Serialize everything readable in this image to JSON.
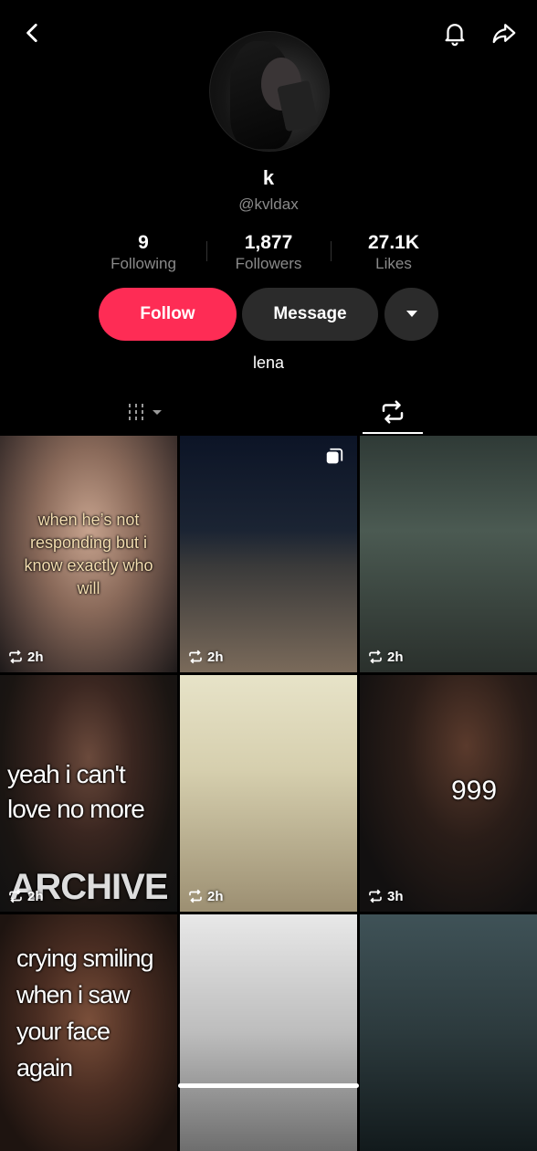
{
  "profile": {
    "display_name": "k",
    "handle": "@kvldax",
    "bio": "lena"
  },
  "stats": {
    "following": {
      "value": "9",
      "label": "Following"
    },
    "followers": {
      "value": "1,877",
      "label": "Followers"
    },
    "likes": {
      "value": "27.1K",
      "label": "Likes"
    }
  },
  "actions": {
    "follow_label": "Follow",
    "message_label": "Message"
  },
  "colors": {
    "accent": "#fe2c55",
    "button_dark": "#2b2b2b",
    "muted_text": "#8a8a8a"
  },
  "icons": [
    "back-icon",
    "bell-icon",
    "share-icon",
    "chevron-down-icon",
    "grid-icon",
    "repost-icon",
    "multi-photo-icon"
  ],
  "videos": [
    {
      "caption": "when he’s not responding but i know exactly who will",
      "time": "2h"
    },
    {
      "caption": "",
      "time": "2h"
    },
    {
      "caption": "",
      "time": "2h"
    },
    {
      "caption": "yeah i can't love no more",
      "time": "2h"
    },
    {
      "caption": "",
      "time": "2h"
    },
    {
      "caption": "999",
      "time": "3h"
    },
    {
      "caption": "crying smiling when i saw your face again",
      "time": ""
    },
    {
      "caption": "",
      "time": ""
    },
    {
      "caption": "",
      "time": ""
    }
  ],
  "overlay_text": {
    "c4_bottom": "ARCHIVE"
  }
}
